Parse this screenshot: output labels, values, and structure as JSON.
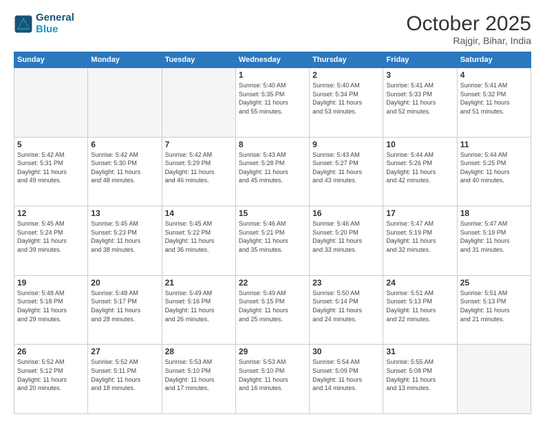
{
  "header": {
    "logo_line1": "General",
    "logo_line2": "Blue",
    "month_year": "October 2025",
    "location": "Rajgir, Bihar, India"
  },
  "weekdays": [
    "Sunday",
    "Monday",
    "Tuesday",
    "Wednesday",
    "Thursday",
    "Friday",
    "Saturday"
  ],
  "weeks": [
    [
      {
        "day": "",
        "info": ""
      },
      {
        "day": "",
        "info": ""
      },
      {
        "day": "",
        "info": ""
      },
      {
        "day": "1",
        "info": "Sunrise: 5:40 AM\nSunset: 5:35 PM\nDaylight: 11 hours\nand 55 minutes."
      },
      {
        "day": "2",
        "info": "Sunrise: 5:40 AM\nSunset: 5:34 PM\nDaylight: 11 hours\nand 53 minutes."
      },
      {
        "day": "3",
        "info": "Sunrise: 5:41 AM\nSunset: 5:33 PM\nDaylight: 11 hours\nand 52 minutes."
      },
      {
        "day": "4",
        "info": "Sunrise: 5:41 AM\nSunset: 5:32 PM\nDaylight: 11 hours\nand 51 minutes."
      }
    ],
    [
      {
        "day": "5",
        "info": "Sunrise: 5:42 AM\nSunset: 5:31 PM\nDaylight: 11 hours\nand 49 minutes."
      },
      {
        "day": "6",
        "info": "Sunrise: 5:42 AM\nSunset: 5:30 PM\nDaylight: 11 hours\nand 48 minutes."
      },
      {
        "day": "7",
        "info": "Sunrise: 5:42 AM\nSunset: 5:29 PM\nDaylight: 11 hours\nand 46 minutes."
      },
      {
        "day": "8",
        "info": "Sunrise: 5:43 AM\nSunset: 5:28 PM\nDaylight: 11 hours\nand 45 minutes."
      },
      {
        "day": "9",
        "info": "Sunrise: 5:43 AM\nSunset: 5:27 PM\nDaylight: 11 hours\nand 43 minutes."
      },
      {
        "day": "10",
        "info": "Sunrise: 5:44 AM\nSunset: 5:26 PM\nDaylight: 11 hours\nand 42 minutes."
      },
      {
        "day": "11",
        "info": "Sunrise: 5:44 AM\nSunset: 5:25 PM\nDaylight: 11 hours\nand 40 minutes."
      }
    ],
    [
      {
        "day": "12",
        "info": "Sunrise: 5:45 AM\nSunset: 5:24 PM\nDaylight: 11 hours\nand 39 minutes."
      },
      {
        "day": "13",
        "info": "Sunrise: 5:45 AM\nSunset: 5:23 PM\nDaylight: 11 hours\nand 38 minutes."
      },
      {
        "day": "14",
        "info": "Sunrise: 5:45 AM\nSunset: 5:22 PM\nDaylight: 11 hours\nand 36 minutes."
      },
      {
        "day": "15",
        "info": "Sunrise: 5:46 AM\nSunset: 5:21 PM\nDaylight: 11 hours\nand 35 minutes."
      },
      {
        "day": "16",
        "info": "Sunrise: 5:46 AM\nSunset: 5:20 PM\nDaylight: 11 hours\nand 33 minutes."
      },
      {
        "day": "17",
        "info": "Sunrise: 5:47 AM\nSunset: 5:19 PM\nDaylight: 11 hours\nand 32 minutes."
      },
      {
        "day": "18",
        "info": "Sunrise: 5:47 AM\nSunset: 5:19 PM\nDaylight: 11 hours\nand 31 minutes."
      }
    ],
    [
      {
        "day": "19",
        "info": "Sunrise: 5:48 AM\nSunset: 5:18 PM\nDaylight: 11 hours\nand 29 minutes."
      },
      {
        "day": "20",
        "info": "Sunrise: 5:48 AM\nSunset: 5:17 PM\nDaylight: 11 hours\nand 28 minutes."
      },
      {
        "day": "21",
        "info": "Sunrise: 5:49 AM\nSunset: 5:16 PM\nDaylight: 11 hours\nand 26 minutes."
      },
      {
        "day": "22",
        "info": "Sunrise: 5:49 AM\nSunset: 5:15 PM\nDaylight: 11 hours\nand 25 minutes."
      },
      {
        "day": "23",
        "info": "Sunrise: 5:50 AM\nSunset: 5:14 PM\nDaylight: 11 hours\nand 24 minutes."
      },
      {
        "day": "24",
        "info": "Sunrise: 5:51 AM\nSunset: 5:13 PM\nDaylight: 11 hours\nand 22 minutes."
      },
      {
        "day": "25",
        "info": "Sunrise: 5:51 AM\nSunset: 5:13 PM\nDaylight: 11 hours\nand 21 minutes."
      }
    ],
    [
      {
        "day": "26",
        "info": "Sunrise: 5:52 AM\nSunset: 5:12 PM\nDaylight: 11 hours\nand 20 minutes."
      },
      {
        "day": "27",
        "info": "Sunrise: 5:52 AM\nSunset: 5:11 PM\nDaylight: 11 hours\nand 18 minutes."
      },
      {
        "day": "28",
        "info": "Sunrise: 5:53 AM\nSunset: 5:10 PM\nDaylight: 11 hours\nand 17 minutes."
      },
      {
        "day": "29",
        "info": "Sunrise: 5:53 AM\nSunset: 5:10 PM\nDaylight: 11 hours\nand 16 minutes."
      },
      {
        "day": "30",
        "info": "Sunrise: 5:54 AM\nSunset: 5:09 PM\nDaylight: 11 hours\nand 14 minutes."
      },
      {
        "day": "31",
        "info": "Sunrise: 5:55 AM\nSunset: 5:08 PM\nDaylight: 11 hours\nand 13 minutes."
      },
      {
        "day": "",
        "info": ""
      }
    ]
  ]
}
